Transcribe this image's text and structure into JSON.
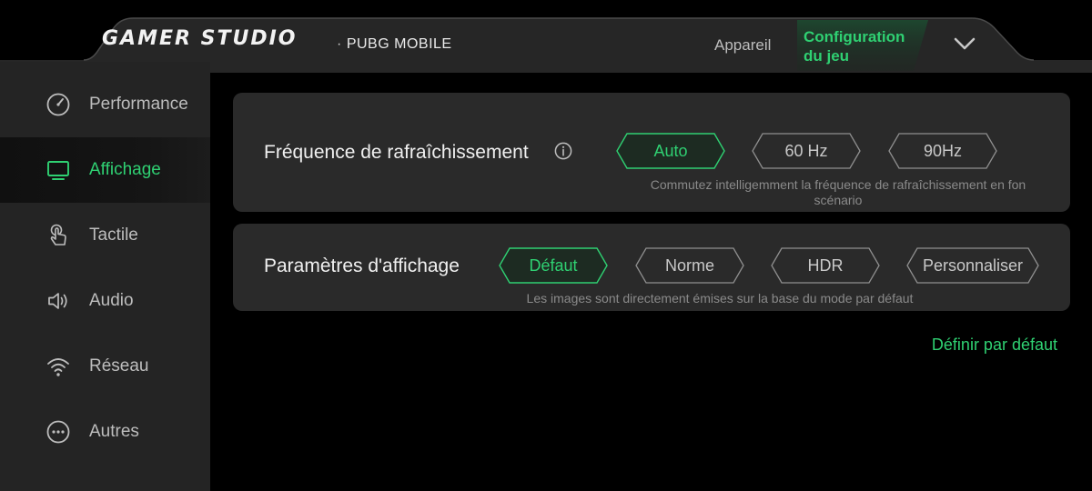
{
  "header": {
    "logo": "GAMER STUDIO",
    "game": "PUBG MOBILE",
    "tabs": [
      {
        "label": "Appareil",
        "active": false
      },
      {
        "label_line1": "Configuration",
        "label_line2": "du jeu",
        "active": true
      }
    ],
    "collapse_icon": "chevron-down-icon"
  },
  "sidebar": {
    "items": [
      {
        "label": "Performance",
        "icon": "speedometer-icon",
        "active": false
      },
      {
        "label": "Affichage",
        "icon": "monitor-icon",
        "active": true
      },
      {
        "label": "Tactile",
        "icon": "touch-icon",
        "active": false
      },
      {
        "label": "Audio",
        "icon": "speaker-icon",
        "active": false
      },
      {
        "label": "Réseau",
        "icon": "wifi-icon",
        "active": false
      },
      {
        "label": "Autres",
        "icon": "more-icon",
        "active": false
      }
    ]
  },
  "refresh": {
    "title": "Fréquence de rafraîchissement",
    "info_icon": "info-icon",
    "options": [
      "Auto",
      "60 Hz",
      "90Hz"
    ],
    "selected": "Auto",
    "desc_line1": "Commutez intelligemment la fréquence de rafraîchissement en fon",
    "desc_line2": "scénario"
  },
  "display": {
    "title": "Paramètres d'affichage",
    "options": [
      "Défaut",
      "Norme",
      "HDR",
      "Personnaliser"
    ],
    "selected": "Défaut",
    "desc": "Les images sont directement émises sur la base du mode par défaut"
  },
  "reset_label": "Définir par défaut",
  "colors": {
    "accent": "#2fd072",
    "sidebar_bg": "#242424",
    "card_bg": "#2a2a2a",
    "header_bg": "#262626"
  }
}
